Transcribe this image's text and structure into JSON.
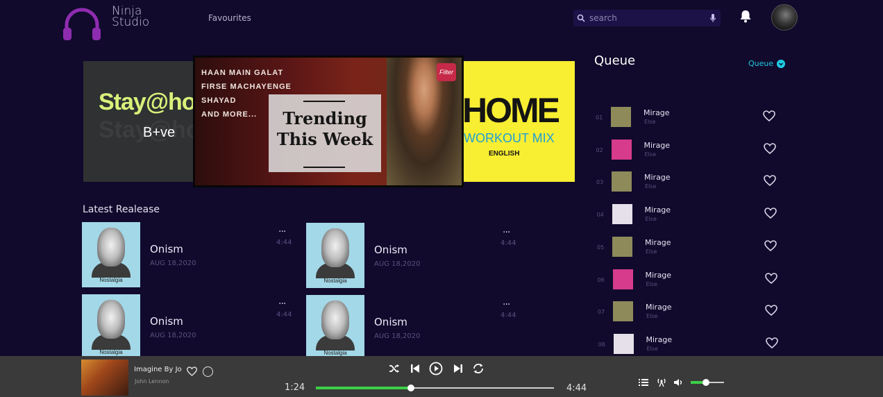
{
  "header": {
    "brand_line1": "Ninja",
    "brand_line2": "Studio",
    "nav_favourites": "Favourites",
    "search_placeholder": "search",
    "accent_color": "#9b2fb8"
  },
  "carousel": {
    "stay": {
      "title": "Stay@hor",
      "subtitle": "B+ve"
    },
    "trending": {
      "lines": [
        "HAAN MAIN GALAT",
        "FIRSE MACHAYENGE",
        "SHAYAD",
        "AND MORE..."
      ],
      "title_line1": "Trending",
      "title_line2": "This Week",
      "badge": "Filter"
    },
    "home": {
      "title": "HOME",
      "subtitle": "WORKOUT MIX",
      "language": "ENGLISH"
    }
  },
  "latest": {
    "title": "Latest Realease",
    "items": [
      {
        "name": "Onism",
        "date": "AUG 18,2020",
        "duration": "4:44",
        "caption": "Nostalgia"
      },
      {
        "name": "Onism",
        "date": "AUG 18,2020",
        "duration": "4:44",
        "caption": "Nostalgia"
      },
      {
        "name": "Onism",
        "date": "AUG 18,2020",
        "duration": "4:44",
        "caption": "Nostalgia"
      },
      {
        "name": "Onism",
        "date": "AUG 18,2020",
        "duration": "4:44",
        "caption": "Nostalgia"
      }
    ],
    "more_icon": "..."
  },
  "queue": {
    "title": "Queue",
    "dropdown_label": "Queue",
    "items": [
      {
        "num": "01",
        "title": "Mirage",
        "artist": "Else",
        "thumb": "#8e8a5a"
      },
      {
        "num": "02",
        "title": "Mirage",
        "artist": "Else",
        "thumb": "#d63b8c"
      },
      {
        "num": "03",
        "title": "Mirage",
        "artist": "Else",
        "thumb": "#8e8a5a"
      },
      {
        "num": "04",
        "title": "Mirage",
        "artist": "Else",
        "thumb": "#e5e0ea"
      },
      {
        "num": "05",
        "title": "Mirage",
        "artist": "Else",
        "thumb": "#8e8a5a"
      },
      {
        "num": "06",
        "title": "Mirage",
        "artist": "Else",
        "thumb": "#d63b8c"
      },
      {
        "num": "07",
        "title": "Mirage",
        "artist": "Else",
        "thumb": "#8e8a5a"
      },
      {
        "num": "08",
        "title": "Mirage",
        "artist": "Else",
        "thumb": "#e5e0ea"
      }
    ]
  },
  "player": {
    "track_title": "Imagine By Jo",
    "track_artist": "John Lennon",
    "time_elapsed": "1:24",
    "time_total": "4:44",
    "progress": 0.4,
    "volume": 0.45,
    "progress_color": "#3cd046"
  }
}
